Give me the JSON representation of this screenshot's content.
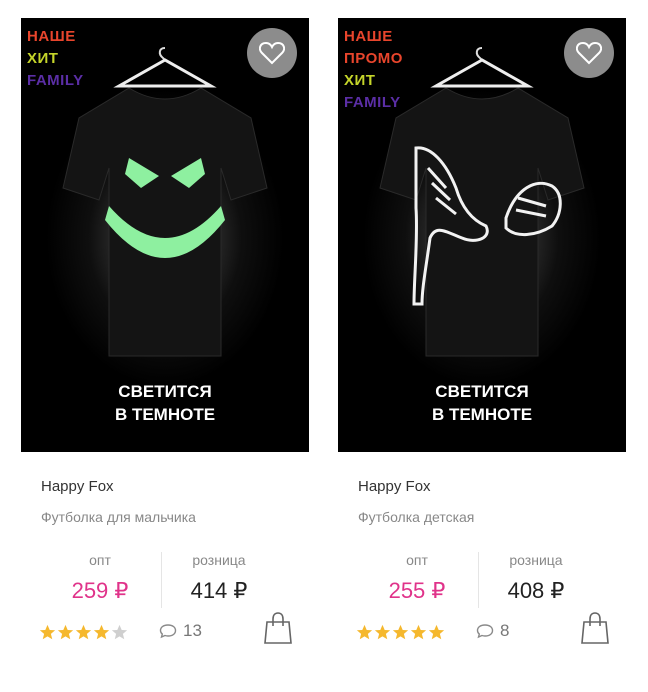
{
  "products": [
    {
      "badges": [
        {
          "text": "НАШЕ",
          "color": "#e8452c"
        },
        {
          "text": "ХИТ",
          "color": "#c5d52a"
        },
        {
          "text": "FAMILY",
          "color": "#5b2ea6"
        }
      ],
      "image_caption_line1": "СВЕТИТСЯ",
      "image_caption_line2": "В ТЕМНОТЕ",
      "print": "glowing-face",
      "brand": "Happy Fox",
      "name": "Футболка для мальчика",
      "opt_label": "опт",
      "opt_price": "259 ₽",
      "retail_label": "розница",
      "retail_price": "414 ₽",
      "rating": 4,
      "comments": "13"
    },
    {
      "badges": [
        {
          "text": "НАШЕ",
          "color": "#e8452c"
        },
        {
          "text": "ПРОМО",
          "color": "#e8452c"
        },
        {
          "text": "ХИТ",
          "color": "#c5d52a"
        },
        {
          "text": "FAMILY",
          "color": "#5b2ea6"
        }
      ],
      "image_caption_line1": "СВЕТИТСЯ",
      "image_caption_line2": "В ТЕМНОТЕ",
      "print": "sneakers",
      "brand": "Happy Fox",
      "name": "Футболка детская",
      "opt_label": "опт",
      "opt_price": "255 ₽",
      "retail_label": "розница",
      "retail_price": "408 ₽",
      "rating": 5,
      "comments": "8"
    }
  ],
  "colors": {
    "opt_price": "#e0338a",
    "star_filled": "#f5b82e",
    "star_empty": "#cfcfcf",
    "favorite_bg": "#8c8c8c"
  }
}
